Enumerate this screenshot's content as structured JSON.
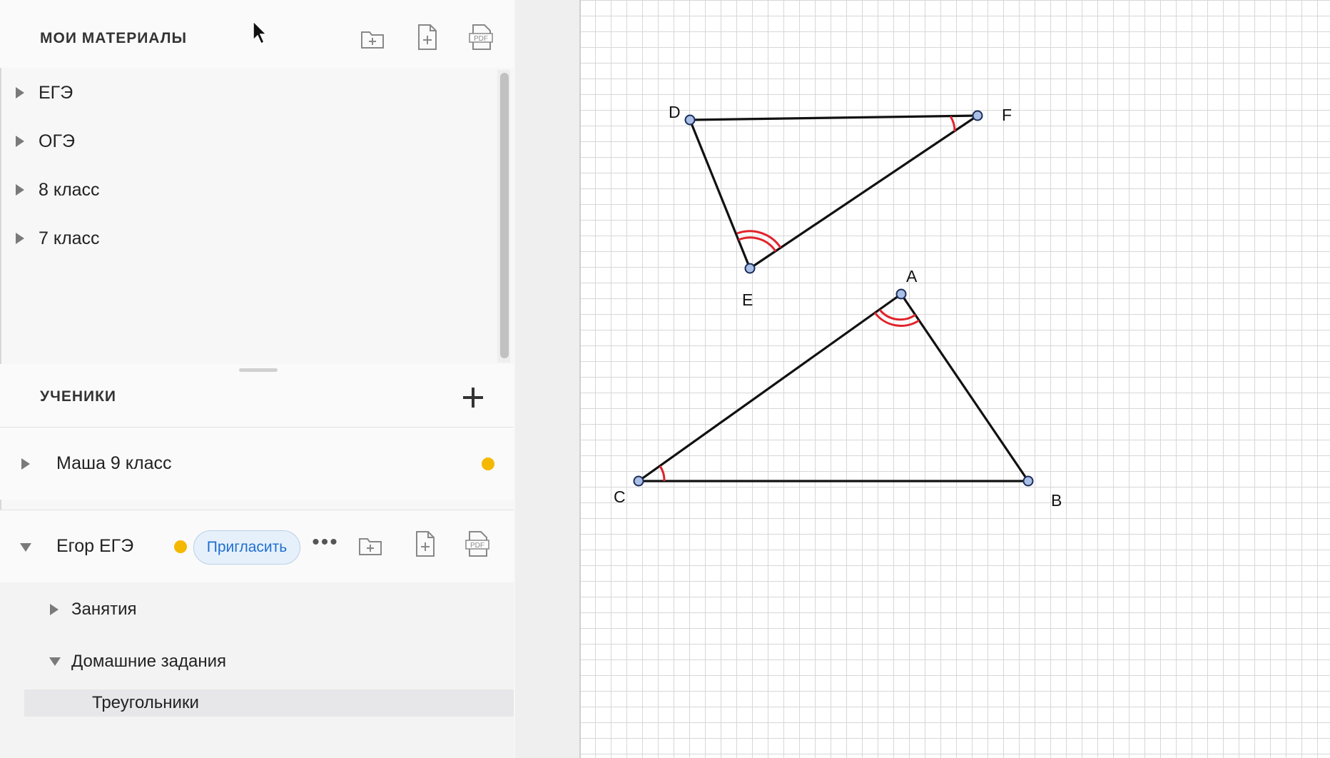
{
  "materials": {
    "title": "МОИ МАТЕРИАЛЫ",
    "actions": [
      "add-folder-icon",
      "add-file-icon",
      "pdf-icon"
    ],
    "items": [
      {
        "label": "ЕГЭ"
      },
      {
        "label": "ОГЭ"
      },
      {
        "label": "8 класс"
      },
      {
        "label": "7 класс"
      }
    ]
  },
  "students": {
    "title": "УЧЕНИКИ",
    "add_icon": "plus-icon",
    "list": [
      {
        "name": "Маша 9 класс",
        "status_color": "#f5b800",
        "expanded": false
      },
      {
        "name": "Егор ЕГЭ",
        "status_color": "#f5b800",
        "expanded": true,
        "invite_label": "Пригласить",
        "more_label": "•••"
      }
    ],
    "egor_children": [
      {
        "label": "Занятия",
        "expanded": false
      },
      {
        "label": "Домашние задания",
        "expanded": true
      }
    ],
    "selected_item": "Треугольники"
  },
  "canvas": {
    "grid": true,
    "points": [
      {
        "label": "D"
      },
      {
        "label": "F"
      },
      {
        "label": "E"
      },
      {
        "label": "A"
      },
      {
        "label": "C"
      },
      {
        "label": "B"
      }
    ],
    "colors": {
      "segment": "#111111",
      "angle_mark": "#e0242b",
      "point_fill": "#a9bfe6",
      "point_stroke": "#1b2d5a"
    }
  }
}
